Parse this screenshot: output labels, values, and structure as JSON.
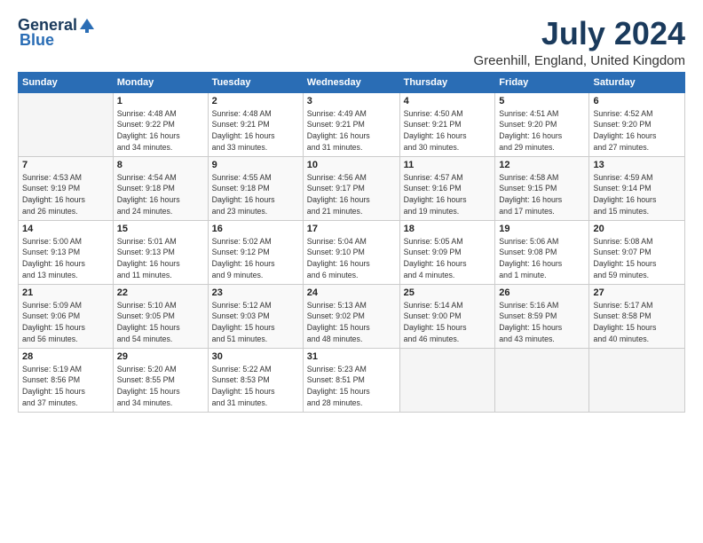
{
  "logo": {
    "general": "General",
    "blue": "Blue"
  },
  "title": "July 2024",
  "location": "Greenhill, England, United Kingdom",
  "days_of_week": [
    "Sunday",
    "Monday",
    "Tuesday",
    "Wednesday",
    "Thursday",
    "Friday",
    "Saturday"
  ],
  "weeks": [
    [
      {
        "num": "",
        "info": ""
      },
      {
        "num": "1",
        "info": "Sunrise: 4:48 AM\nSunset: 9:22 PM\nDaylight: 16 hours\nand 34 minutes."
      },
      {
        "num": "2",
        "info": "Sunrise: 4:48 AM\nSunset: 9:21 PM\nDaylight: 16 hours\nand 33 minutes."
      },
      {
        "num": "3",
        "info": "Sunrise: 4:49 AM\nSunset: 9:21 PM\nDaylight: 16 hours\nand 31 minutes."
      },
      {
        "num": "4",
        "info": "Sunrise: 4:50 AM\nSunset: 9:21 PM\nDaylight: 16 hours\nand 30 minutes."
      },
      {
        "num": "5",
        "info": "Sunrise: 4:51 AM\nSunset: 9:20 PM\nDaylight: 16 hours\nand 29 minutes."
      },
      {
        "num": "6",
        "info": "Sunrise: 4:52 AM\nSunset: 9:20 PM\nDaylight: 16 hours\nand 27 minutes."
      }
    ],
    [
      {
        "num": "7",
        "info": "Sunrise: 4:53 AM\nSunset: 9:19 PM\nDaylight: 16 hours\nand 26 minutes."
      },
      {
        "num": "8",
        "info": "Sunrise: 4:54 AM\nSunset: 9:18 PM\nDaylight: 16 hours\nand 24 minutes."
      },
      {
        "num": "9",
        "info": "Sunrise: 4:55 AM\nSunset: 9:18 PM\nDaylight: 16 hours\nand 23 minutes."
      },
      {
        "num": "10",
        "info": "Sunrise: 4:56 AM\nSunset: 9:17 PM\nDaylight: 16 hours\nand 21 minutes."
      },
      {
        "num": "11",
        "info": "Sunrise: 4:57 AM\nSunset: 9:16 PM\nDaylight: 16 hours\nand 19 minutes."
      },
      {
        "num": "12",
        "info": "Sunrise: 4:58 AM\nSunset: 9:15 PM\nDaylight: 16 hours\nand 17 minutes."
      },
      {
        "num": "13",
        "info": "Sunrise: 4:59 AM\nSunset: 9:14 PM\nDaylight: 16 hours\nand 15 minutes."
      }
    ],
    [
      {
        "num": "14",
        "info": "Sunrise: 5:00 AM\nSunset: 9:13 PM\nDaylight: 16 hours\nand 13 minutes."
      },
      {
        "num": "15",
        "info": "Sunrise: 5:01 AM\nSunset: 9:13 PM\nDaylight: 16 hours\nand 11 minutes."
      },
      {
        "num": "16",
        "info": "Sunrise: 5:02 AM\nSunset: 9:12 PM\nDaylight: 16 hours\nand 9 minutes."
      },
      {
        "num": "17",
        "info": "Sunrise: 5:04 AM\nSunset: 9:10 PM\nDaylight: 16 hours\nand 6 minutes."
      },
      {
        "num": "18",
        "info": "Sunrise: 5:05 AM\nSunset: 9:09 PM\nDaylight: 16 hours\nand 4 minutes."
      },
      {
        "num": "19",
        "info": "Sunrise: 5:06 AM\nSunset: 9:08 PM\nDaylight: 16 hours\nand 1 minute."
      },
      {
        "num": "20",
        "info": "Sunrise: 5:08 AM\nSunset: 9:07 PM\nDaylight: 15 hours\nand 59 minutes."
      }
    ],
    [
      {
        "num": "21",
        "info": "Sunrise: 5:09 AM\nSunset: 9:06 PM\nDaylight: 15 hours\nand 56 minutes."
      },
      {
        "num": "22",
        "info": "Sunrise: 5:10 AM\nSunset: 9:05 PM\nDaylight: 15 hours\nand 54 minutes."
      },
      {
        "num": "23",
        "info": "Sunrise: 5:12 AM\nSunset: 9:03 PM\nDaylight: 15 hours\nand 51 minutes."
      },
      {
        "num": "24",
        "info": "Sunrise: 5:13 AM\nSunset: 9:02 PM\nDaylight: 15 hours\nand 48 minutes."
      },
      {
        "num": "25",
        "info": "Sunrise: 5:14 AM\nSunset: 9:00 PM\nDaylight: 15 hours\nand 46 minutes."
      },
      {
        "num": "26",
        "info": "Sunrise: 5:16 AM\nSunset: 8:59 PM\nDaylight: 15 hours\nand 43 minutes."
      },
      {
        "num": "27",
        "info": "Sunrise: 5:17 AM\nSunset: 8:58 PM\nDaylight: 15 hours\nand 40 minutes."
      }
    ],
    [
      {
        "num": "28",
        "info": "Sunrise: 5:19 AM\nSunset: 8:56 PM\nDaylight: 15 hours\nand 37 minutes."
      },
      {
        "num": "29",
        "info": "Sunrise: 5:20 AM\nSunset: 8:55 PM\nDaylight: 15 hours\nand 34 minutes."
      },
      {
        "num": "30",
        "info": "Sunrise: 5:22 AM\nSunset: 8:53 PM\nDaylight: 15 hours\nand 31 minutes."
      },
      {
        "num": "31",
        "info": "Sunrise: 5:23 AM\nSunset: 8:51 PM\nDaylight: 15 hours\nand 28 minutes."
      },
      {
        "num": "",
        "info": ""
      },
      {
        "num": "",
        "info": ""
      },
      {
        "num": "",
        "info": ""
      }
    ]
  ]
}
